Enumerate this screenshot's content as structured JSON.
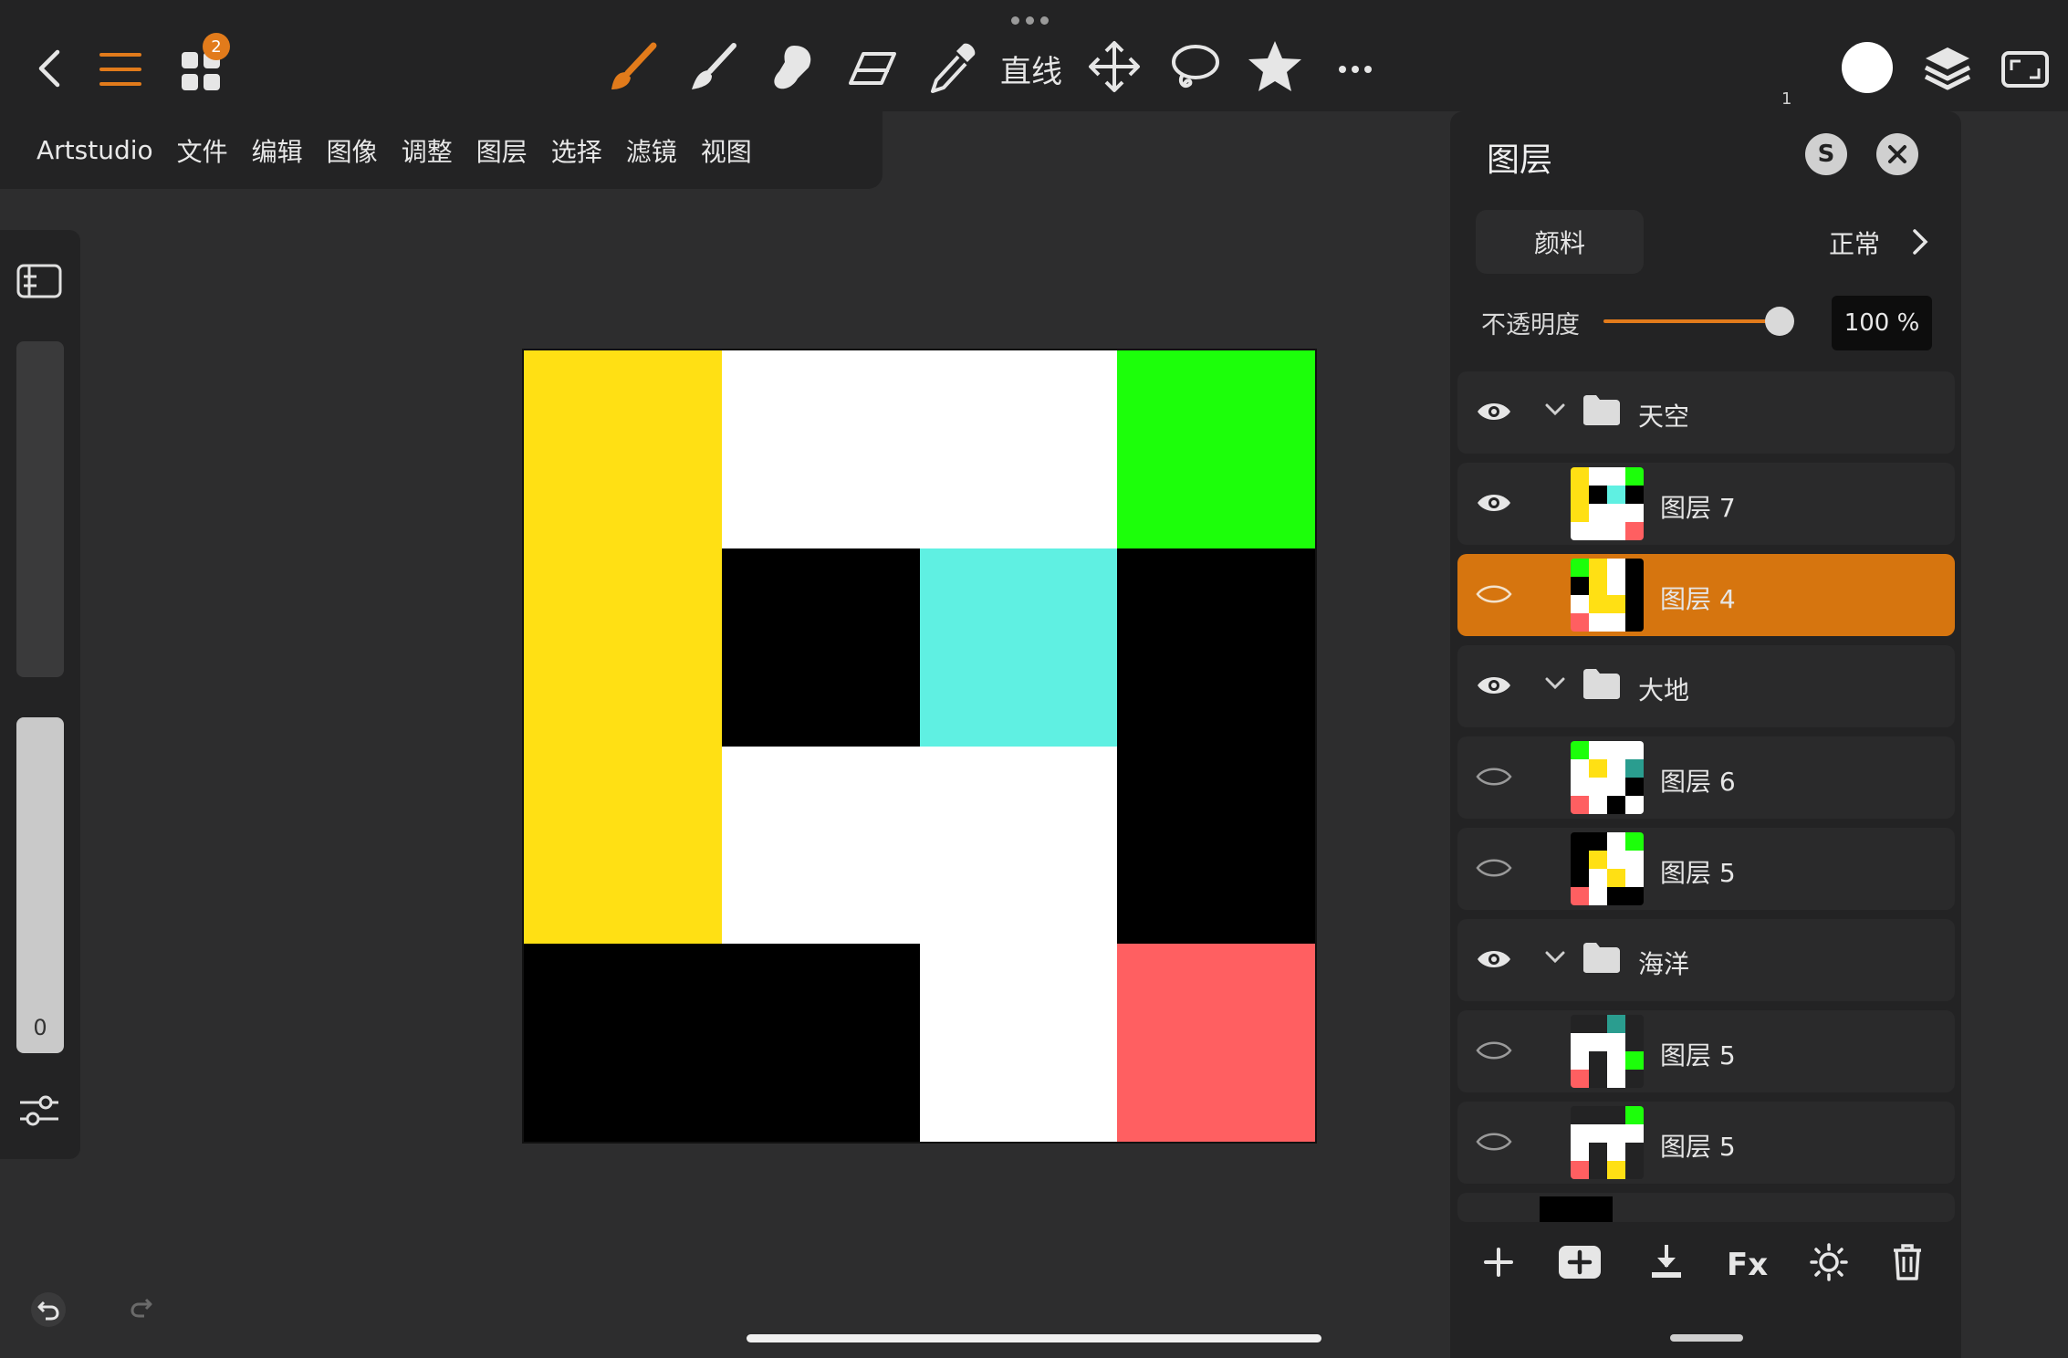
{
  "toolbar": {
    "apps_badge": "2",
    "line_tool_label": "直线",
    "small_count": "1",
    "icons": [
      "back-icon",
      "menu-icon",
      "apps-icon",
      "paintbrush-icon",
      "brush-icon",
      "smudge-icon",
      "eraser-icon",
      "eyedropper-icon",
      "move-icon",
      "lasso-icon",
      "star-icon",
      "more-icon",
      "color-swatch-icon",
      "layers-icon",
      "fullscreen-icon"
    ],
    "accent": "#e27b1b"
  },
  "menu": {
    "items": [
      "Artstudio",
      "文件",
      "编辑",
      "图像",
      "调整",
      "图层",
      "选择",
      "滤镜",
      "视图"
    ]
  },
  "left_panel": {
    "size_value": "0"
  },
  "canvas": {
    "cells": [
      "#ffe014",
      "#ffffff",
      "#ffffff",
      "#1cff0a",
      "#ffe014",
      "#000000",
      "#5ff0e2",
      "#000000",
      "#ffe014",
      "#ffffff",
      "#ffffff",
      "#000000",
      "#000000",
      "#000000",
      "#ffffff",
      "#ff5f61"
    ]
  },
  "layers": {
    "title": "图层",
    "s_button": "S",
    "paint_tab": "颜料",
    "blend_mode": "正常",
    "opacity_label": "不透明度",
    "opacity_value": "100 %",
    "opacity_fraction": 1.0,
    "rows": [
      {
        "type": "group",
        "name": "天空",
        "visible": true
      },
      {
        "type": "layer",
        "name": "图层 7",
        "visible": true,
        "selected": false,
        "thumb": [
          "#ffe014",
          "#ffffff",
          "#ffffff",
          "#1cff0a",
          "#ffe014",
          "#000000",
          "#5ff0e2",
          "#000000",
          "#ffe014",
          "#ffffff",
          "#ffffff",
          "#ffffff",
          "#ffffff",
          "#ffffff",
          "#ffffff",
          "#ff5f61"
        ]
      },
      {
        "type": "layer",
        "name": "图层 4",
        "visible": false,
        "selected": true,
        "thumb": [
          "#1cff0a",
          "#ffe014",
          "#ffffff",
          "#000000",
          "#000000",
          "#ffe014",
          "#ffffff",
          "#000000",
          "#ffffff",
          "#ffe014",
          "#ffe014",
          "#000000",
          "#ff5f61",
          "#ffffff",
          "#ffffff",
          "#000000"
        ]
      },
      {
        "type": "group",
        "name": "大地",
        "visible": true
      },
      {
        "type": "layer",
        "name": "图层 6",
        "visible": false,
        "selected": false,
        "thumb": [
          "#1cff0a",
          "#ffffff",
          "#ffffff",
          "#ffffff",
          "#ffffff",
          "#ffe014",
          "#ffffff",
          "#2a9d8f",
          "#ffffff",
          "#ffffff",
          "#ffffff",
          "#000000",
          "#ff5f61",
          "#ffffff",
          "#000000",
          "#ffffff"
        ]
      },
      {
        "type": "layer",
        "name": "图层 5",
        "visible": false,
        "selected": false,
        "thumb": [
          "#000000",
          "#000000",
          "#ffffff",
          "#1cff0a",
          "#000000",
          "#ffe014",
          "#ffffff",
          "#ffffff",
          "#000000",
          "#ffffff",
          "#ffe014",
          "#ffffff",
          "#ff5f61",
          "#ffffff",
          "#000000",
          "#000000"
        ]
      },
      {
        "type": "group",
        "name": "海洋",
        "visible": true
      },
      {
        "type": "layer",
        "name": "图层 5",
        "visible": false,
        "selected": false,
        "thumb": [
          "#232324",
          "#232324",
          "#2a9d8f",
          "#232324",
          "#ffffff",
          "#ffffff",
          "#ffffff",
          "#232324",
          "#ffffff",
          "#232324",
          "#ffffff",
          "#1cff0a",
          "#ff5f61",
          "#232324",
          "#ffffff",
          "#232324"
        ]
      },
      {
        "type": "layer",
        "name": "图层 5",
        "visible": false,
        "selected": false,
        "thumb": [
          "#232324",
          "#232324",
          "#232324",
          "#1cff0a",
          "#ffffff",
          "#ffffff",
          "#ffffff",
          "#ffffff",
          "#ffffff",
          "#232324",
          "#ffffff",
          "#232324",
          "#ff5f61",
          "#232324",
          "#ffe014",
          "#232324"
        ]
      }
    ],
    "bottom_icons": [
      "add-layer-icon",
      "add-group-icon",
      "merge-down-icon",
      "fx-icon",
      "adjust-icon",
      "delete-icon"
    ],
    "fx_label": "Fx"
  }
}
